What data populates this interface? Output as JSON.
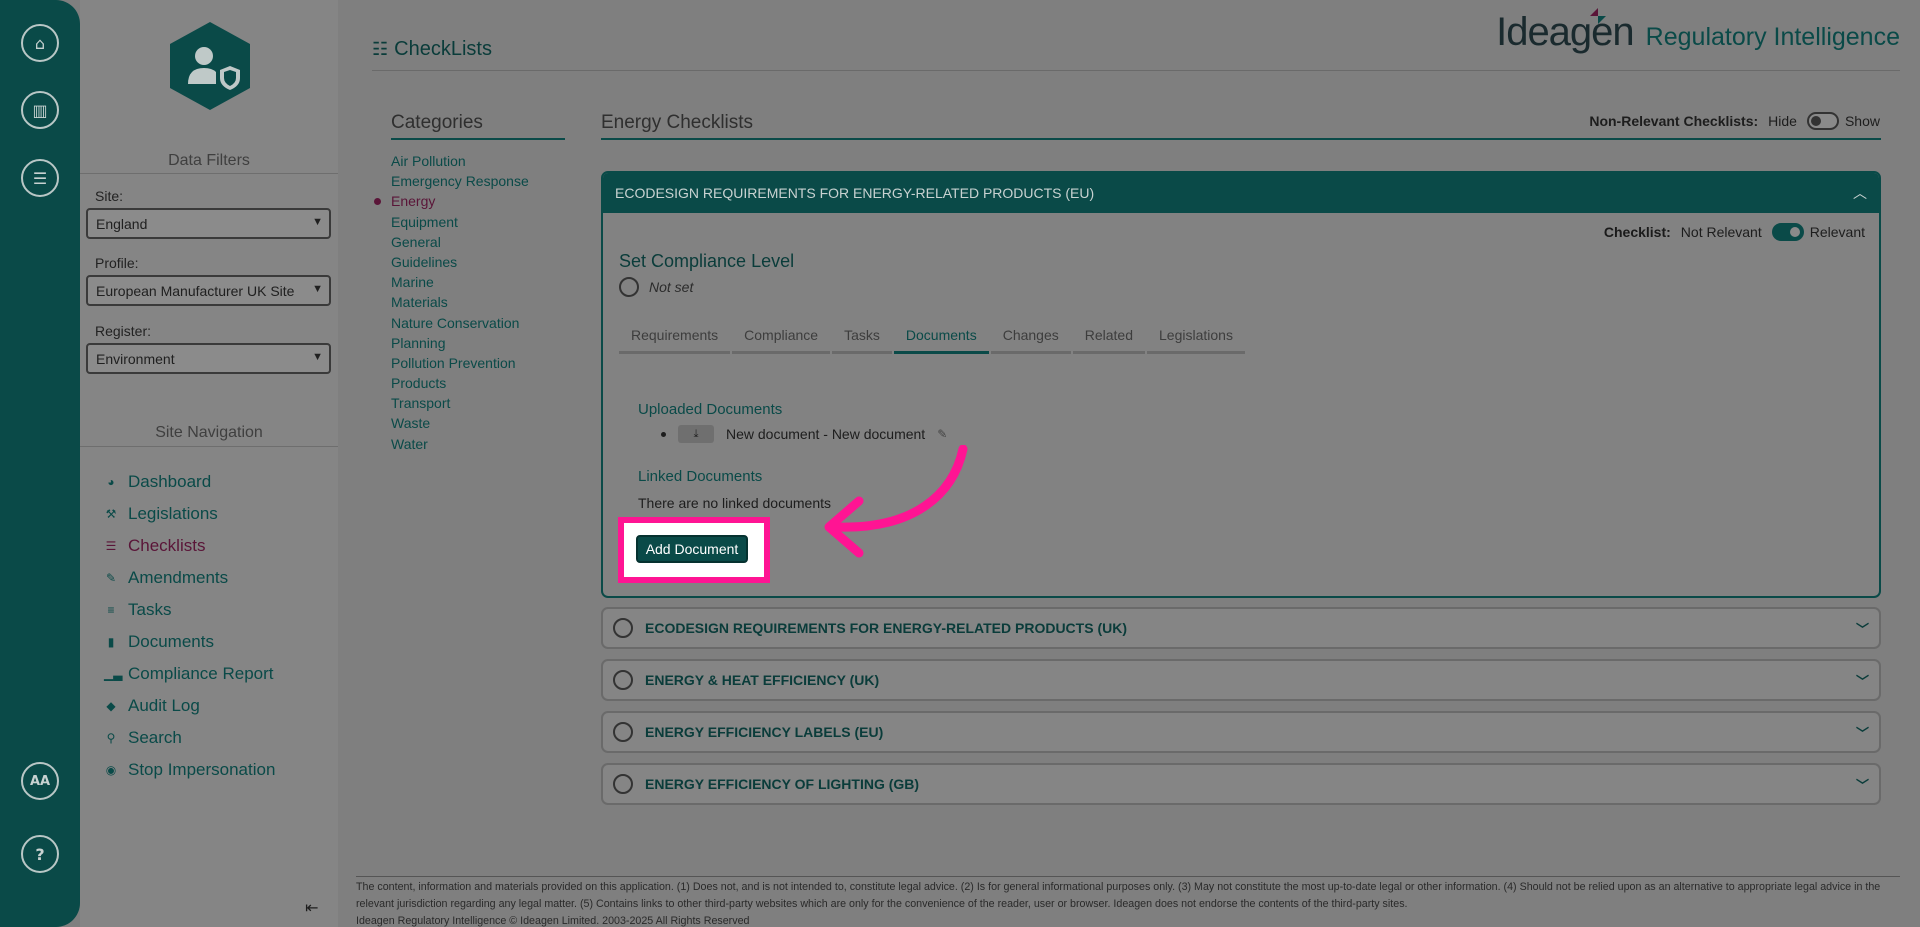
{
  "rail": {
    "icons": [
      "home-icon",
      "building-icon",
      "sliders-icon",
      "accessibility-icon",
      "help-icon"
    ],
    "accessibility_label": "AA",
    "help_label": "?"
  },
  "sidebar": {
    "data_filters_title": "Data Filters",
    "site_label": "Site:",
    "site_value": "England",
    "profile_label": "Profile:",
    "profile_value": "European Manufacturer UK Site",
    "register_label": "Register:",
    "register_value": "Environment",
    "site_navigation_title": "Site Navigation",
    "nav": [
      {
        "label": "Dashboard",
        "icon": "dashboard-icon"
      },
      {
        "label": "Legislations",
        "icon": "gavel-icon"
      },
      {
        "label": "Checklists",
        "icon": "list-icon",
        "active": true
      },
      {
        "label": "Amendments",
        "icon": "edit-icon"
      },
      {
        "label": "Tasks",
        "icon": "tasks-icon"
      },
      {
        "label": "Documents",
        "icon": "file-icon"
      },
      {
        "label": "Compliance Report",
        "icon": "bar-chart-icon"
      },
      {
        "label": "Audit Log",
        "icon": "tags-icon"
      },
      {
        "label": "Search",
        "icon": "search-icon"
      },
      {
        "label": "Stop Impersonation",
        "icon": "stop-circle-icon"
      }
    ],
    "collapse_icon": "collapse-left-icon"
  },
  "header": {
    "title": "CheckLists",
    "brand_name": "Ideagen",
    "brand_product": "Regulatory Intelligence"
  },
  "categories": {
    "title": "Categories",
    "items": [
      "Air Pollution",
      "Emergency Response",
      "Energy",
      "Equipment",
      "General",
      "Guidelines",
      "Marine",
      "Materials",
      "Nature Conservation",
      "Planning",
      "Pollution Prevention",
      "Products",
      "Transport",
      "Waste",
      "Water"
    ],
    "active": "Energy"
  },
  "section": {
    "title": "Energy Checklists",
    "non_relevant_label": "Non-Relevant Checklists:",
    "hide_label": "Hide",
    "show_label": "Show"
  },
  "panel": {
    "title": "ECODESIGN REQUIREMENTS FOR ENERGY-RELATED PRODUCTS (EU)",
    "checklist_label": "Checklist:",
    "not_relevant_label": "Not Relevant",
    "relevant_label": "Relevant",
    "compliance_title": "Set Compliance Level",
    "compliance_value": "Not set",
    "tabs": [
      "Requirements",
      "Compliance",
      "Tasks",
      "Documents",
      "Changes",
      "Related",
      "Legislations"
    ],
    "active_tab": "Documents",
    "uploaded_title": "Uploaded Documents",
    "uploaded_doc": "New document - New document",
    "linked_title": "Linked Documents",
    "linked_empty": "There are no linked documents",
    "add_button": "Add Document"
  },
  "accordions": [
    "ECODESIGN REQUIREMENTS FOR ENERGY-RELATED PRODUCTS (UK)",
    "ENERGY & HEAT EFFICIENCY (UK)",
    "ENERGY EFFICIENCY LABELS (EU)",
    "ENERGY EFFICIENCY OF LIGHTING (GB)"
  ],
  "footer": {
    "disclaimer": "The content, information and materials provided on this application. (1) Does not, and is not intended to, constitute legal advice. (2) Is for general informational purposes only. (3) May not constitute the most up-to-date legal or other information. (4) Should not be relied upon as an alternative to appropriate legal advice in the relevant jurisdiction regarding any legal matter. (5) Contains links to other third-party websites which are only for the convenience of the reader, user or browser. Ideagen does not endorse the contents of the third-party sites.",
    "copyright": "Ideagen Regulatory Intelligence © Ideagen Limited. 2003-2025 All Rights Reserved"
  },
  "colors": {
    "primary": "#0a4a48",
    "active_nav": "#5a1538",
    "highlight": "#ff1493"
  }
}
